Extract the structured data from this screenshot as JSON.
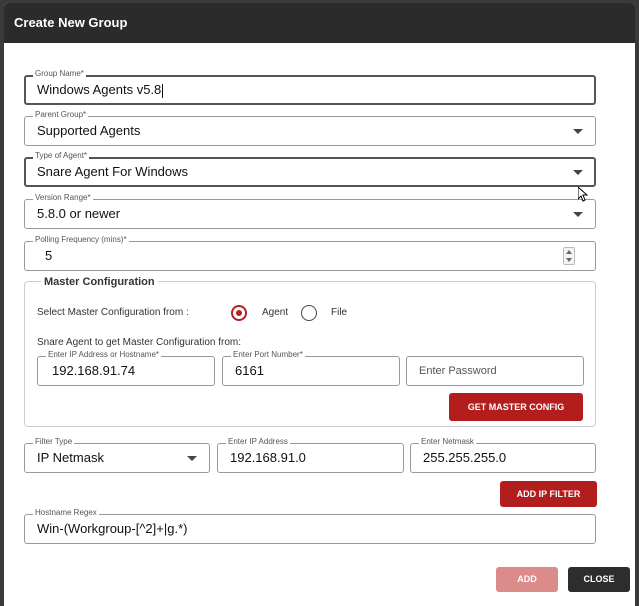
{
  "dialog": {
    "title": "Create New Group",
    "fields": {
      "group_name": {
        "label": "Group Name*",
        "value": "Windows Agents v5.8"
      },
      "parent_group": {
        "label": "Parent Group*",
        "value": "Supported Agents"
      },
      "agent_type": {
        "label": "Type of Agent*",
        "value": "Snare Agent For Windows"
      },
      "version_range": {
        "label": "Version Range*",
        "value": "5.8.0 or newer"
      },
      "polling_frequency": {
        "label": "Polling Frequency (mins)*",
        "value": "5"
      }
    },
    "master_config": {
      "legend": "Master Configuration",
      "select_label": "Select Master Configuration from :",
      "option_agent": "Agent",
      "option_file": "File",
      "selected": "Agent",
      "agent_hint": "Snare Agent to get Master Configuration from:",
      "ip_label": "Enter IP Address or Hostname*",
      "ip_value": "192.168.91.74",
      "port_label": "Enter Port Number*",
      "port_value": "6161",
      "password_placeholder": "Enter Password",
      "get_button": "GET MASTER CONFIG"
    },
    "filter": {
      "type_label": "Filter Type",
      "type_value": "IP Netmask",
      "ip_label": "Enter IP Address",
      "ip_value": "192.168.91.0",
      "netmask_label": "Enter Netmask",
      "netmask_value": "255.255.255.0",
      "add_button": "ADD IP FILTER"
    },
    "hostname_regex": {
      "label": "Hostname Regex",
      "value": "Win-(Workgroup-[^2]+|g.*)"
    },
    "footer": {
      "add": "ADD",
      "close": "CLOSE"
    },
    "colors": {
      "accent": "#b21d1d",
      "accent_disabled": "#dc8b8b",
      "titlebar": "#2b2b2b"
    }
  }
}
